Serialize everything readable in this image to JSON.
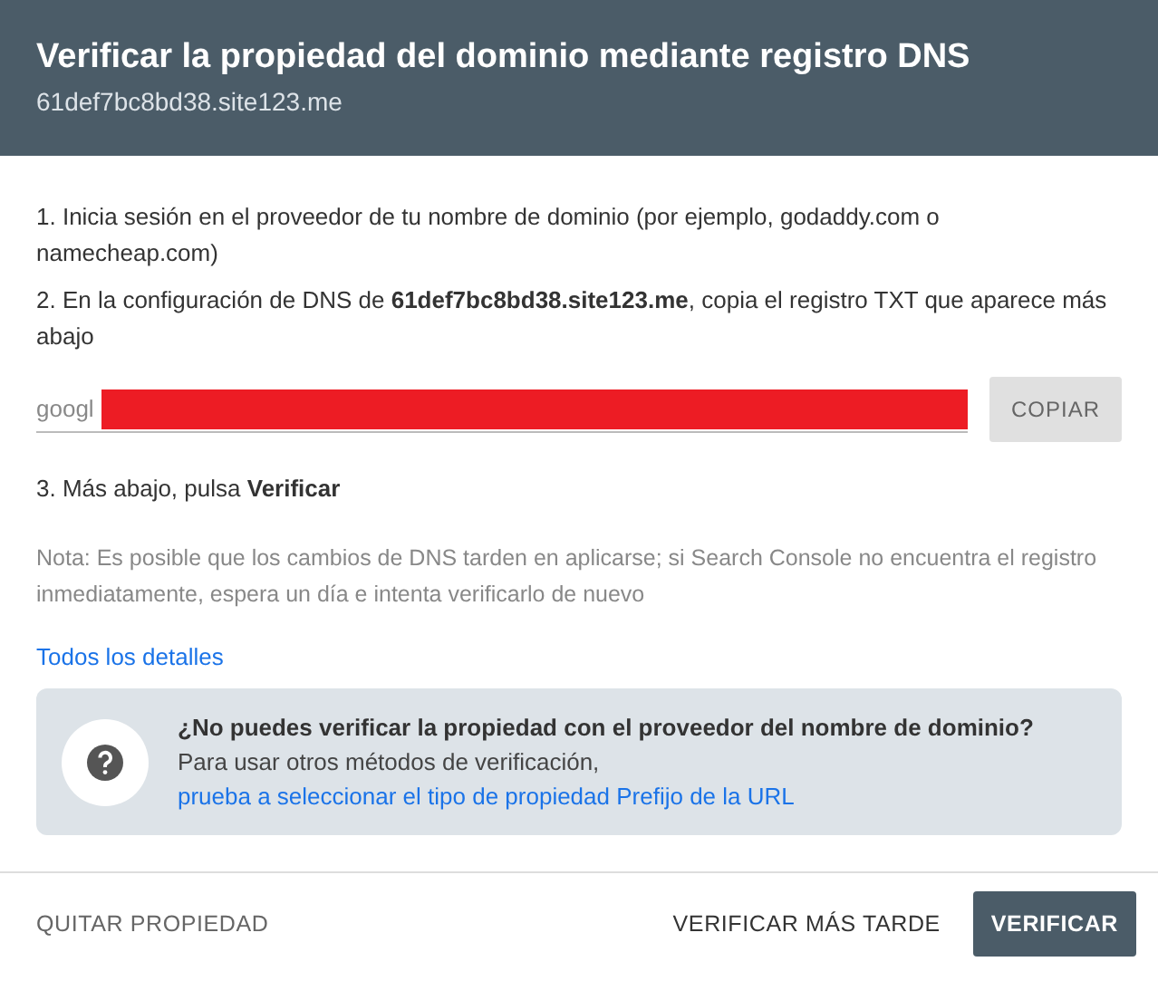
{
  "header": {
    "title": "Verificar la propiedad del dominio mediante registro DNS",
    "subtitle": "61def7bc8bd38.site123.me"
  },
  "steps": [
    "1. Inicia sesión en el proveedor de tu nombre de dominio (por ejemplo, godaddy.com o namecheap.com)",
    "2. En la configuración de DNS de **61def7bc8bd38.site123.me**, copia el registro TXT que aparece más abajo"
  ],
  "record": {
    "value": "googl",
    "redacted": true,
    "copy_button": "COPIAR"
  },
  "step3": "3. Más abajo, pulsa **Verificar**",
  "note": "Nota: Es posible que los cambios de DNS tarden en aplicarse; si Search Console no encuentra el registro inmediatamente, espera un día e intenta verificarlo de nuevo",
  "details_link": "Todos los detalles",
  "info": {
    "title": "¿No puedes verificar la propiedad con el proveedor del nombre de dominio?",
    "text": "Para usar otros métodos de verificación,",
    "link": "prueba a seleccionar el tipo de propiedad Prefijo de la URL"
  },
  "footer": {
    "left_button": "QUITAR PROPIEDAD",
    "buttons": [
      {
        "label": "VERIFICAR MÁS TARDE",
        "kind": "text"
      },
      {
        "label": "VERIFICAR",
        "kind": "primary"
      }
    ]
  }
}
